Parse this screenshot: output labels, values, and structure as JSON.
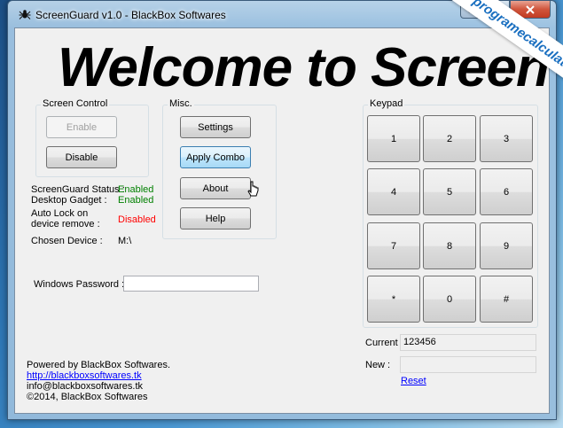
{
  "window": {
    "title": "ScreenGuard v1.0 - BlackBox Softwares"
  },
  "banner": {
    "text": "Welcome to Screen"
  },
  "screen_control": {
    "label": "Screen Control",
    "enable_label": "Enable",
    "disable_label": "Disable"
  },
  "misc": {
    "label": "Misc.",
    "settings_label": "Settings",
    "apply_combo_label": "Apply Combo",
    "about_label": "About",
    "help_label": "Help"
  },
  "status": {
    "screenguard_status_label": "ScreenGuard Status :",
    "screenguard_status_value": "Enabled",
    "desktop_gadget_label": "Desktop Gadget :",
    "desktop_gadget_value": "Enabled",
    "auto_lock_label_1": "Auto Lock on",
    "auto_lock_label_2": "device remove :",
    "auto_lock_value": "Disabled",
    "chosen_device_label": "Chosen Device :",
    "chosen_device_value": "M:\\"
  },
  "windows_password": {
    "label": "Windows Password :",
    "value": ""
  },
  "footer": {
    "powered_by": "Powered by BlackBox Softwares.",
    "website": "http://blackboxsoftwares.tk",
    "email": "info@blackboxsoftwares.tk",
    "copyright": "©2014, BlackBox Softwares"
  },
  "keypad": {
    "label": "Keypad",
    "keys": [
      "1",
      "2",
      "3",
      "4",
      "5",
      "6",
      "7",
      "8",
      "9",
      "*",
      "0",
      "#"
    ]
  },
  "combo": {
    "current_label": "Current :",
    "current_value": "123456",
    "new_label": "New :",
    "new_value": "",
    "reset_label": "Reset"
  },
  "watermark": {
    "text": "programecalculator.ro"
  },
  "colors": {
    "enabled": "#008000",
    "disabled": "#ff0000",
    "link": "#0000ff"
  }
}
